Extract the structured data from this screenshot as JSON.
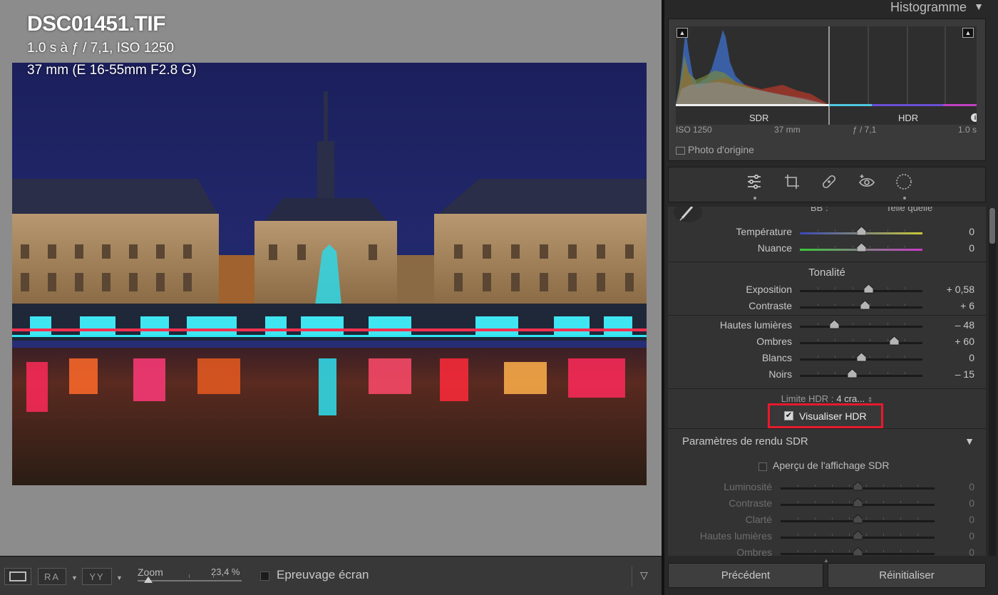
{
  "photo": {
    "filename": "DSC01451.TIF",
    "exposure_line": "1.0 s à ƒ / 7,1, ISO 1250",
    "lens_line": "37 mm (E 16-55mm F2.8 G)"
  },
  "toolbar": {
    "ra_label": "RA",
    "yy_label": "YY",
    "zoom_label": "Zoom",
    "zoom_value": "23,4 %",
    "zoom_fraction": 0.1,
    "proof_label": "Epreuvage écran",
    "proof_checked": false
  },
  "histogram": {
    "title": "Histogramme",
    "sdr_label": "SDR",
    "hdr_label": "HDR",
    "iso": "ISO 1250",
    "focal": "37 mm",
    "aperture": "ƒ / 7,1",
    "shutter": "1.0 s",
    "photo_origin_label": "Photo d'origine"
  },
  "tools": [
    "edit-sliders-icon",
    "crop-icon",
    "heal-icon",
    "redeye-icon",
    "mask-icon"
  ],
  "basic": {
    "wb_label": "BB :",
    "wb_value": "Telle quelle",
    "white_balance_rows": [
      {
        "label": "Température",
        "value": "0",
        "pos": 0.5
      },
      {
        "label": "Nuance",
        "value": "0",
        "pos": 0.5
      }
    ],
    "tone_title": "Tonalité",
    "tone_rows_1": [
      {
        "label": "Exposition",
        "value": "+ 0,58",
        "pos": 0.56
      },
      {
        "label": "Contraste",
        "value": "+ 6",
        "pos": 0.53
      }
    ],
    "tone_rows_2": [
      {
        "label": "Hautes lumières",
        "value": "– 48",
        "pos": 0.28
      },
      {
        "label": "Ombres",
        "value": "+ 60",
        "pos": 0.77
      },
      {
        "label": "Blancs",
        "value": "0",
        "pos": 0.5
      },
      {
        "label": "Noirs",
        "value": "– 15",
        "pos": 0.43
      }
    ],
    "hdr_limit_label": "Limite HDR :",
    "hdr_limit_value": "4 cra...",
    "visualize_hdr_label": "Visualiser HDR",
    "visualize_hdr_checked": true
  },
  "sdr": {
    "title": "Paramètres de rendu SDR",
    "preview_label": "Aperçu de l'affichage SDR",
    "rows": [
      {
        "label": "Luminosité",
        "value": "0",
        "pos": 0.5
      },
      {
        "label": "Contraste",
        "value": "0",
        "pos": 0.5
      },
      {
        "label": "Clarté",
        "value": "0",
        "pos": 0.5
      },
      {
        "label": "Hautes lumières",
        "value": "0",
        "pos": 0.5
      },
      {
        "label": "Ombres",
        "value": "0",
        "pos": 0.5
      }
    ]
  },
  "footer": {
    "prev_label": "Précédent",
    "reset_label": "Réinitialiser"
  },
  "colors": {
    "highlight_border": "#e8192c",
    "hdr_bar": "#4fc8e0",
    "hdr_bar_purple": "#6a4fd6"
  }
}
